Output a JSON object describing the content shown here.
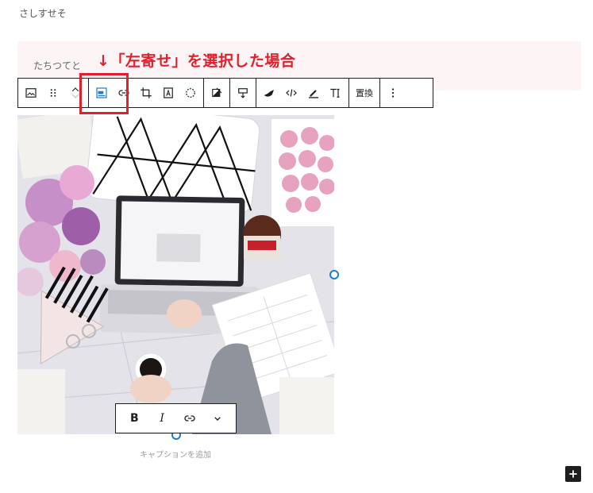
{
  "paragraphs": {
    "top": "さしすせそ",
    "pink_block": "たちつてと"
  },
  "annotation": {
    "text": "↓「左寄せ」を選択した場合",
    "color": "#e0202a"
  },
  "toolbar": {
    "icons": [
      "image-icon",
      "drag-handle-icon",
      "move-up-down-icon",
      "align-left-icon",
      "link-icon",
      "crop-icon",
      "text-overlay-icon",
      "select-circle-icon",
      "duotone-icon",
      "upload-icon",
      "highlighter-brush-icon",
      "code-icon",
      "pen-icon",
      "text-format-icon",
      "more-options-icon"
    ],
    "replace_label": "置換"
  },
  "caption_toolbar": {
    "bold_label": "B",
    "italic_label": "I"
  },
  "caption": {
    "placeholder": "キャプションを追加"
  },
  "colors": {
    "accent_red": "#e0202a",
    "handle_blue": "#1e7bd6",
    "active_blue": "#1e7bd6",
    "pink_bg": "#fdf4f6"
  }
}
